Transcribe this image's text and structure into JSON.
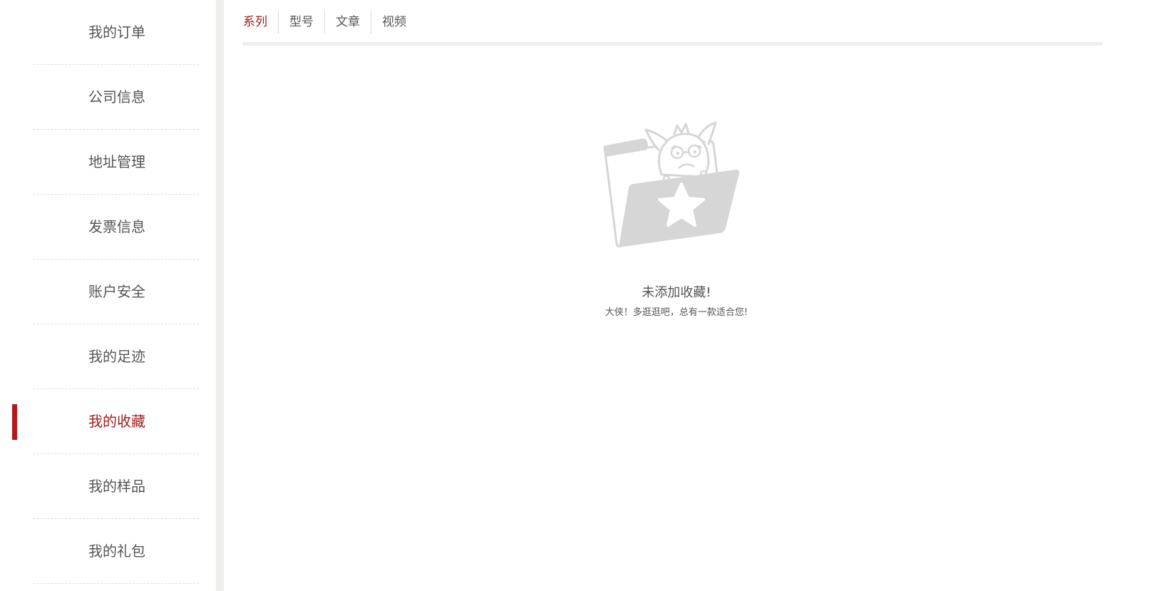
{
  "sidebar": {
    "items": [
      {
        "label": "我的订单",
        "active": false
      },
      {
        "label": "公司信息",
        "active": false
      },
      {
        "label": "地址管理",
        "active": false
      },
      {
        "label": "发票信息",
        "active": false
      },
      {
        "label": "账户安全",
        "active": false
      },
      {
        "label": "我的足迹",
        "active": false
      },
      {
        "label": "我的收藏",
        "active": true
      },
      {
        "label": "我的样品",
        "active": false
      },
      {
        "label": "我的礼包",
        "active": false
      }
    ]
  },
  "tabs": [
    {
      "label": "系列",
      "active": true
    },
    {
      "label": "型号",
      "active": false
    },
    {
      "label": "文章",
      "active": false
    },
    {
      "label": "视频",
      "active": false
    }
  ],
  "empty_state": {
    "title": "未添加收藏!",
    "subtitle": "大侠！多逛逛吧，总有一款适合您!"
  },
  "colors": {
    "accent": "#9f1c20",
    "indicator": "#b5161b",
    "text": "#555555",
    "illustration": "#d6d6d6"
  }
}
